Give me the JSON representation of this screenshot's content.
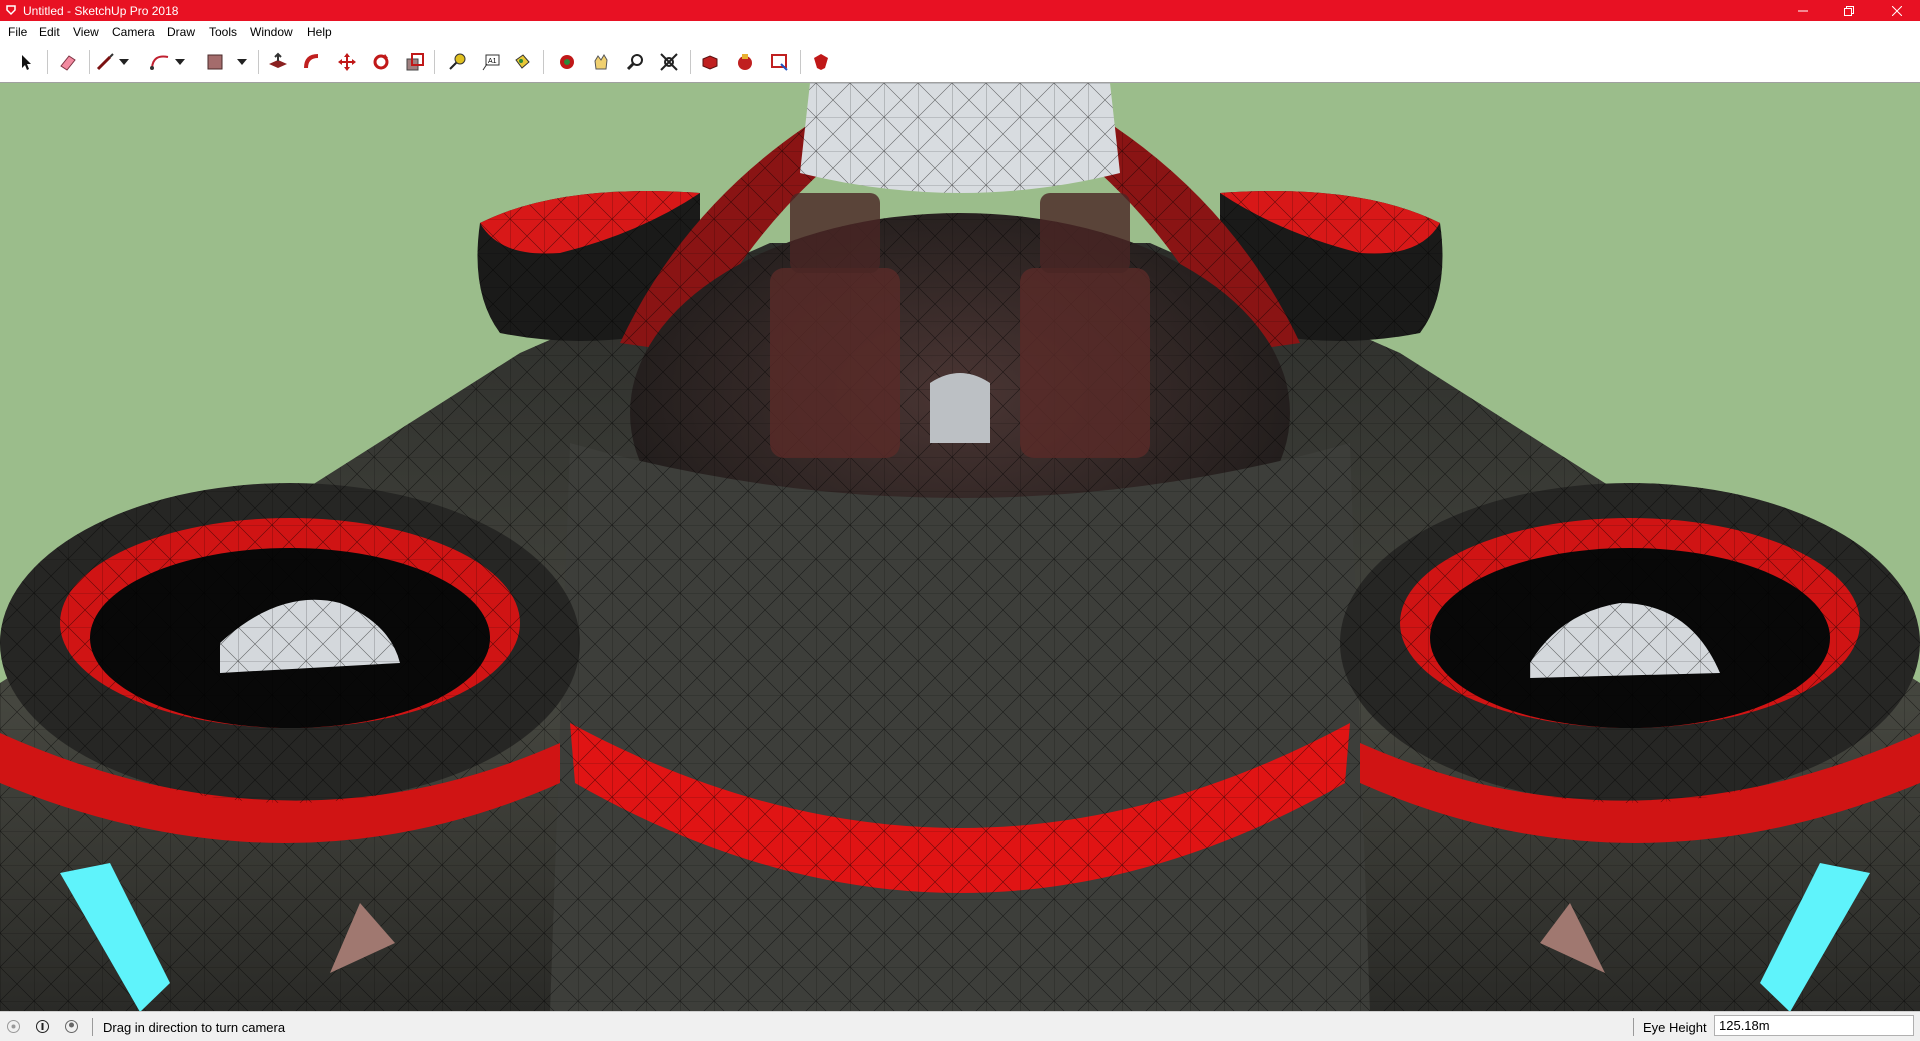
{
  "window": {
    "title": "Untitled - SketchUp Pro 2018",
    "title_bar_color": "#e81123"
  },
  "menubar": {
    "items": [
      "File",
      "Edit",
      "View",
      "Camera",
      "Draw",
      "Tools",
      "Window",
      "Help"
    ]
  },
  "toolbar": {
    "tools": [
      "select-icon",
      "eraser-icon",
      "line-icon",
      "arc-icon",
      "rectangle-icon",
      "push-pull-icon",
      "follow-me-icon",
      "move-icon",
      "rotate-icon",
      "scale-icon",
      "tape-measure-icon",
      "text-icon",
      "paint-bucket-icon",
      "orbit-icon",
      "pan-icon",
      "zoom-icon",
      "zoom-extents-icon",
      "3d-warehouse-icon",
      "extension-warehouse-icon",
      "layout-icon",
      "extension-manager-icon"
    ]
  },
  "viewport": {
    "background_color": "#9bbd8b",
    "model_colors": [
      "#3a3b38",
      "#e01010",
      "#c8ccd2",
      "#5ff3fb",
      "#a07870"
    ]
  },
  "status": {
    "message": "Drag in direction to turn camera",
    "vcb_label": "Eye Height",
    "vcb_value": "125.18m"
  }
}
